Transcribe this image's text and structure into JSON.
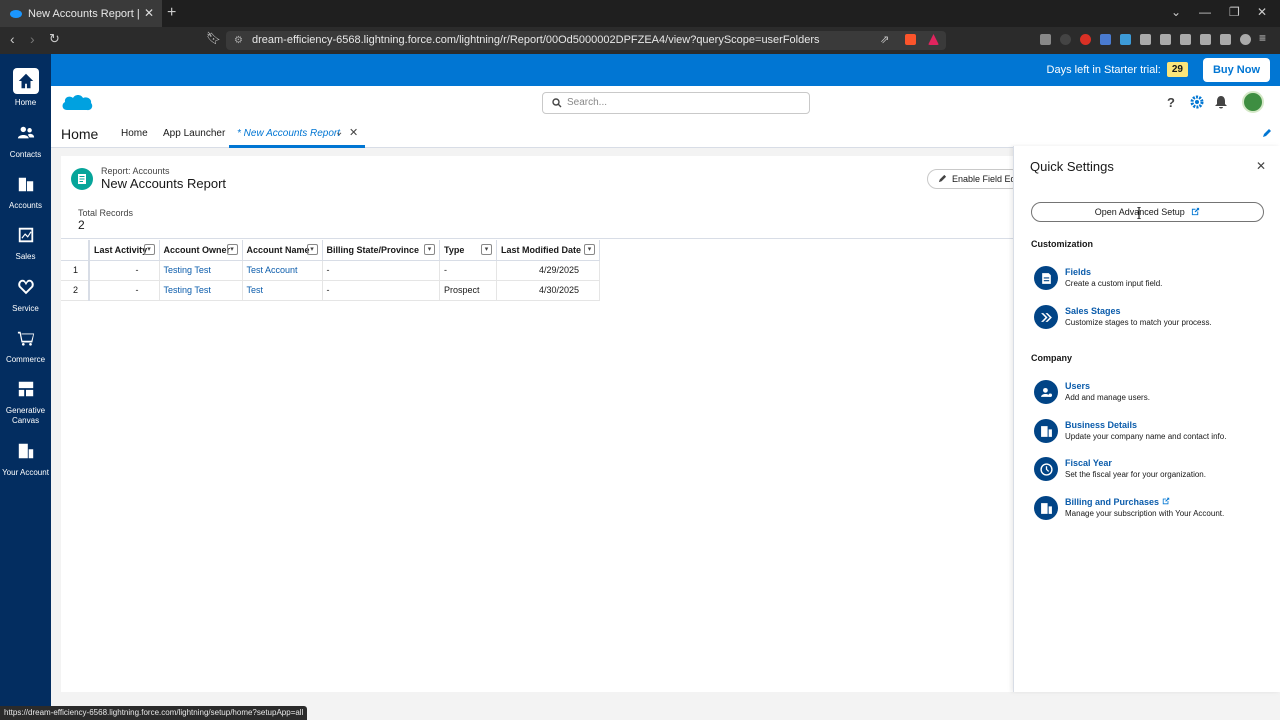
{
  "browser": {
    "tab_title": "New Accounts Report | Salesfor",
    "url": "dream-efficiency-6568.lightning.force.com/lightning/r/Report/00Od5000002DPFZEA4/view?queryScope=userFolders",
    "status_url": "https://dream-efficiency-6568.lightning.force.com/lightning/setup/home?setupApp=all"
  },
  "topbar": {
    "trial_label": "Days left in Starter trial:",
    "trial_days": "29",
    "buy_now": "Buy Now"
  },
  "search": {
    "placeholder": "Search..."
  },
  "sidenav": [
    {
      "label": "Home",
      "icon": "home-icon"
    },
    {
      "label": "Contacts",
      "icon": "contacts-icon"
    },
    {
      "label": "Accounts",
      "icon": "accounts-icon"
    },
    {
      "label": "Sales",
      "icon": "sales-icon"
    },
    {
      "label": "Service",
      "icon": "service-icon"
    },
    {
      "label": "Commerce",
      "icon": "cart-icon"
    },
    {
      "label": "Generative Canvas",
      "icon": "canvas-icon"
    },
    {
      "label": "Your Account",
      "icon": "building-icon"
    }
  ],
  "navbar": {
    "app_title": "Home",
    "links": [
      "Home",
      "App Launcher"
    ],
    "active_tab": "* New Accounts Report"
  },
  "report": {
    "subtitle": "Report: Accounts",
    "title": "New Accounts Report",
    "enable_field_editing": "Enable Field Edit",
    "total_label": "Total Records",
    "total_value": "2",
    "columns": [
      "Last Activity",
      "Account Owner",
      "Account Name",
      "Billing State/Province",
      "Type",
      "Last Modified Date"
    ],
    "rows": [
      {
        "num": "1",
        "last_activity": "-",
        "owner": "Testing Test",
        "account": "Test Account",
        "state": "-",
        "type": "-",
        "modified": "4/29/2025"
      },
      {
        "num": "2",
        "last_activity": "-",
        "owner": "Testing Test",
        "account": "Test",
        "state": "-",
        "type": "Prospect",
        "modified": "4/30/2025"
      }
    ]
  },
  "quick_settings": {
    "title": "Quick Settings",
    "open_setup": "Open Advanced Setup",
    "customization_heading": "Customization",
    "company_heading": "Company",
    "customization": [
      {
        "name": "Fields",
        "desc": "Create a custom input field."
      },
      {
        "name": "Sales Stages",
        "desc": "Customize stages to match your process."
      }
    ],
    "company": [
      {
        "name": "Users",
        "desc": "Add and manage users."
      },
      {
        "name": "Business Details",
        "desc": "Update your company name and contact info."
      },
      {
        "name": "Fiscal Year",
        "desc": "Set the fiscal year for your organization."
      },
      {
        "name": "Billing and Purchases",
        "desc": "Manage your subscription with Your Account."
      }
    ]
  },
  "colors": {
    "brand_blue": "#0176d3",
    "nav_dark": "#032d60",
    "link": "#0b5cab",
    "report_icon": "#06a59a",
    "qs_icon": "#014486"
  }
}
